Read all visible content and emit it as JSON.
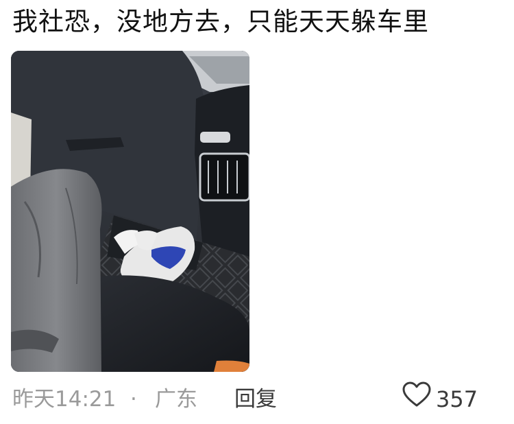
{
  "post": {
    "text": "我社恐，没地方去，只能天天躲车里",
    "image": {
      "subject": "car-interior-photo"
    }
  },
  "meta": {
    "time": "昨天14:21",
    "separator": "·",
    "location": "广东",
    "reply_label": "回复",
    "like_icon": "heart-outline-icon",
    "like_count": "357"
  },
  "colors": {
    "meta_gray": "#9a9a9a",
    "action_dark": "#3a3a3a"
  }
}
